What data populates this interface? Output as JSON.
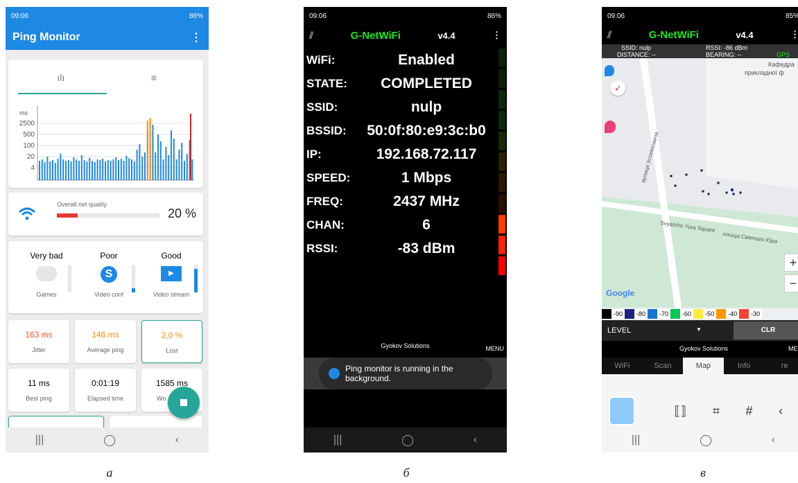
{
  "phone_a": {
    "status_time": "09:06",
    "status_battery": "86%",
    "title": "Ping Monitor",
    "menu_icon": "kebab-icon",
    "tabs": [
      {
        "icon": "bar-chart-icon"
      },
      {
        "icon": "list-icon"
      }
    ],
    "chart": {
      "unit": "ms",
      "y_ticks": [
        "2500",
        "500",
        "100",
        "20",
        "4"
      ]
    },
    "quality": {
      "label": "Overall net quality",
      "value": "20 %",
      "fraction": 0.2,
      "icon": "wifi-icon"
    },
    "usages": [
      {
        "rating": "Very bad",
        "label": "Games",
        "icon": "gamepad-icon",
        "level": 0.0
      },
      {
        "rating": "Poor",
        "label": "Video conf",
        "icon": "skype-icon",
        "level": 0.15
      },
      {
        "rating": "Good",
        "label": "Video stream",
        "icon": "tv-play-icon",
        "level": 0.85
      }
    ],
    "stats": [
      {
        "value": "163 ms",
        "label": "Jitter",
        "color": "#f4511e"
      },
      {
        "value": "146 ms",
        "label": "Average ping",
        "color": "#fb8c00"
      },
      {
        "value": "2,0 %",
        "label": "Lost",
        "color": "#fb8c00"
      },
      {
        "value": "11 ms",
        "label": "Best ping",
        "color": "#222222"
      },
      {
        "value": "0:01:19",
        "label": "Elapsed time",
        "color": "#222222"
      },
      {
        "value": "1585 ms",
        "label": "Wo",
        "color": "#222222"
      }
    ],
    "nav": [
      "|||",
      "◯",
      "‹"
    ]
  },
  "phone_b": {
    "status_time": "09:06",
    "status_battery": "86%",
    "app_name": "G-NetWiFi",
    "version": "v4.4",
    "rows": [
      {
        "key": "WiFi:",
        "value": "Enabled"
      },
      {
        "key": "STATE:",
        "value": "COMPLETED"
      },
      {
        "key": "SSID:",
        "value": "nulp"
      },
      {
        "key": "BSSID:",
        "value": "50:0f:80:e9:3c:b0"
      },
      {
        "key": "IP:",
        "value": "192.168.72.117"
      },
      {
        "key": "SPEED:",
        "value": "1 Mbps"
      },
      {
        "key": "FREQ:",
        "value": "2437 MHz"
      },
      {
        "key": "CHAN:",
        "value": "6"
      },
      {
        "key": "RSSI:",
        "value": "-83 dBm"
      }
    ],
    "brand": "Gyokov Solutions",
    "menu": "MENU",
    "toast": "Ping monitor is running in the background.",
    "nav": [
      "|||",
      "◯",
      "‹"
    ]
  },
  "phone_c": {
    "status_time": "09:06",
    "status_battery": "85%",
    "app_name": "G-NetWiFi",
    "version": "v4.4",
    "ssid": "SSID: nulp",
    "rssi": "RSSI: -86 dBm",
    "distance": "DISTANCE: --",
    "bearing": "BEARING: --",
    "gps": "GPS",
    "map_labels": {
      "street": "вулиця Устияновича",
      "square": "Svyatoho Yura Square",
      "square_ua": "площа Святого Юра",
      "poi1": "Кафедра",
      "poi2": "прикладної ф"
    },
    "zoom_in": "+",
    "zoom_out": "−",
    "google": "Google",
    "legend": [
      {
        "label": "-90",
        "color": "#000000"
      },
      {
        "label": "-80",
        "color": "#1a237e"
      },
      {
        "label": "-70",
        "color": "#1976d2"
      },
      {
        "label": "-60",
        "color": "#00c853"
      },
      {
        "label": "-50",
        "color": "#ffeb3b"
      },
      {
        "label": "-40",
        "color": "#ff9800"
      },
      {
        "label": "-30",
        "color": "#f44336"
      }
    ],
    "level": "LEVEL",
    "clr": "CLR",
    "brand": "Gyokov Solutions",
    "menu": "MEN",
    "tabs": [
      "WiFi",
      "Scan",
      "Map",
      "Info",
      "re"
    ],
    "active_tab": "Map",
    "nav": [
      "|||",
      "◯",
      "‹"
    ]
  },
  "captions": [
    "а",
    "б",
    "в"
  ]
}
